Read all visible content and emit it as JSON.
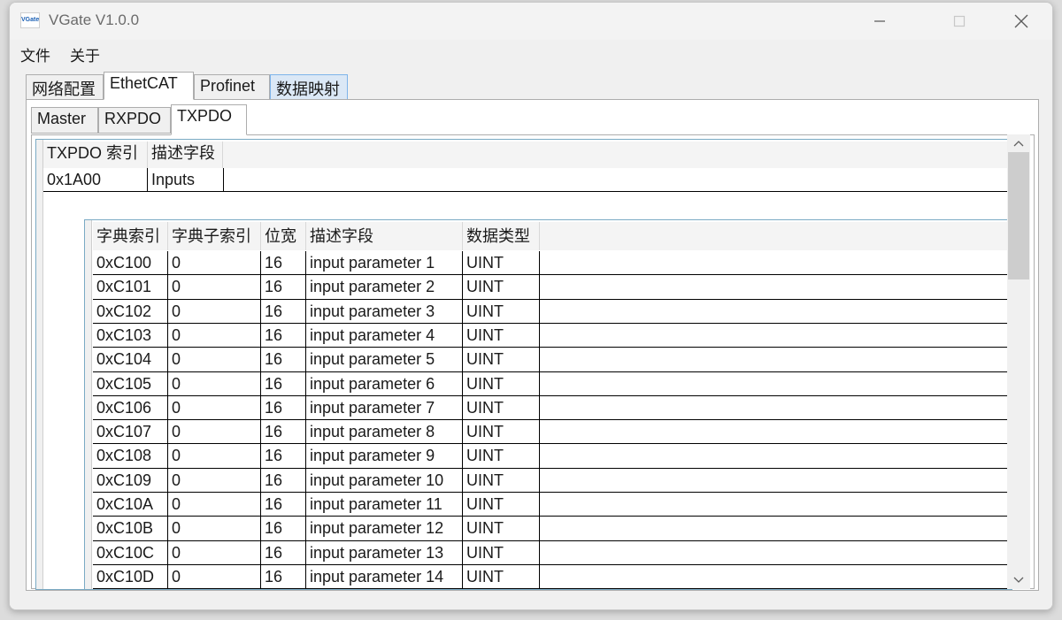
{
  "window": {
    "title": "VGate V1.0.0",
    "logo_text": "VGate"
  },
  "menu": [
    "文件",
    "关于"
  ],
  "main_tabs": [
    "网络配置",
    "EthetCAT",
    "Profinet",
    "数据映射"
  ],
  "sub_tabs": [
    "Master",
    "RXPDO",
    "TXPDO"
  ],
  "pdo_table": {
    "headers": [
      "TXPDO 索引",
      "描述字段"
    ],
    "rows": [
      {
        "index": "0x1A00",
        "desc": "Inputs"
      }
    ]
  },
  "entry_table": {
    "headers": [
      "字典索引",
      "字典子索引",
      "位宽",
      "描述字段",
      "数据类型"
    ],
    "rows": [
      [
        "0xC100",
        "0",
        "16",
        "input parameter 1",
        "UINT"
      ],
      [
        "0xC101",
        "0",
        "16",
        "input parameter 2",
        "UINT"
      ],
      [
        "0xC102",
        "0",
        "16",
        "input parameter 3",
        "UINT"
      ],
      [
        "0xC103",
        "0",
        "16",
        "input parameter 4",
        "UINT"
      ],
      [
        "0xC104",
        "0",
        "16",
        "input parameter 5",
        "UINT"
      ],
      [
        "0xC105",
        "0",
        "16",
        "input parameter 6",
        "UINT"
      ],
      [
        "0xC106",
        "0",
        "16",
        "input parameter 7",
        "UINT"
      ],
      [
        "0xC107",
        "0",
        "16",
        "input parameter 8",
        "UINT"
      ],
      [
        "0xC108",
        "0",
        "16",
        "input parameter 9",
        "UINT"
      ],
      [
        "0xC109",
        "0",
        "16",
        "input parameter 10",
        "UINT"
      ],
      [
        "0xC10A",
        "0",
        "16",
        "input parameter 11",
        "UINT"
      ],
      [
        "0xC10B",
        "0",
        "16",
        "input parameter 12",
        "UINT"
      ],
      [
        "0xC10C",
        "0",
        "16",
        "input parameter 13",
        "UINT"
      ],
      [
        "0xC10D",
        "0",
        "16",
        "input parameter 14",
        "UINT"
      ]
    ]
  }
}
